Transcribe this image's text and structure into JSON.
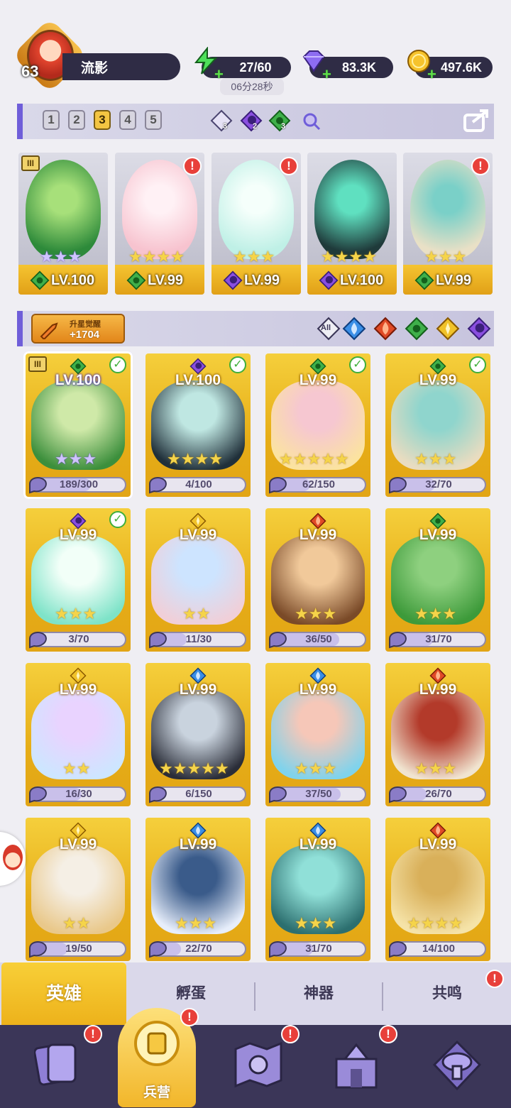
{
  "player": {
    "level": "63",
    "name": "流影"
  },
  "resources": {
    "energy": {
      "value": "27/60",
      "timer": "06分28秒",
      "icon": "lightning-icon"
    },
    "gems": {
      "value": "83.3K",
      "icon": "gem-icon"
    },
    "gold": {
      "value": "497.6K",
      "icon": "coin-icon"
    }
  },
  "team_tabs": [
    "1",
    "2",
    "3",
    "4",
    "5"
  ],
  "active_team_tab": "3",
  "team_element_counts": [
    {
      "element": "light",
      "count": "3"
    },
    {
      "element": "dark",
      "count": "2"
    },
    {
      "element": "nature",
      "count": "3"
    }
  ],
  "lineup": [
    {
      "level": "LV.100",
      "element": "nature",
      "stars": 3,
      "star_color": "purple",
      "tier": "III",
      "alert": false
    },
    {
      "level": "LV.99",
      "element": "nature",
      "stars": 4,
      "star_color": "gold",
      "tier": "",
      "alert": true
    },
    {
      "level": "LV.99",
      "element": "dark",
      "stars": 3,
      "star_color": "gold",
      "tier": "",
      "alert": true
    },
    {
      "level": "LV.100",
      "element": "dark",
      "stars": 4,
      "star_color": "gold",
      "tier": "",
      "alert": false
    },
    {
      "level": "LV.99",
      "element": "nature",
      "stars": 3,
      "star_color": "gold",
      "tier": "",
      "alert": true
    }
  ],
  "awaken": {
    "label": "升星觉醒",
    "value": "+1704"
  },
  "filters": [
    "All",
    "water",
    "fire",
    "nature",
    "light",
    "dark"
  ],
  "filter_all_label": "All",
  "heroes": [
    {
      "level": "LV.100",
      "element": "nature",
      "stars": 3,
      "star_color": "purple",
      "progress": "189/300",
      "ratio": 0.63,
      "checked": true,
      "tier": "III",
      "selected": true
    },
    {
      "level": "LV.100",
      "element": "dark",
      "stars": 4,
      "star_color": "gold",
      "progress": "4/100",
      "ratio": 0.04,
      "checked": true,
      "tier": "",
      "selected": false
    },
    {
      "level": "LV.99",
      "element": "nature",
      "stars": 5,
      "star_color": "gold",
      "progress": "62/150",
      "ratio": 0.41,
      "checked": true,
      "tier": "",
      "selected": false
    },
    {
      "level": "LV.99",
      "element": "nature",
      "stars": 3,
      "star_color": "gold",
      "progress": "32/70",
      "ratio": 0.46,
      "checked": true,
      "tier": "",
      "selected": false
    },
    {
      "level": "LV.99",
      "element": "dark",
      "stars": 3,
      "star_color": "gold",
      "progress": "3/70",
      "ratio": 0.04,
      "checked": true,
      "tier": "",
      "selected": false
    },
    {
      "level": "LV.99",
      "element": "light",
      "stars": 2,
      "star_color": "gold",
      "progress": "11/30",
      "ratio": 0.37,
      "checked": false,
      "tier": "",
      "selected": false
    },
    {
      "level": "LV.99",
      "element": "fire",
      "stars": 3,
      "star_color": "gold",
      "progress": "36/50",
      "ratio": 0.72,
      "checked": false,
      "tier": "",
      "selected": false
    },
    {
      "level": "LV.99",
      "element": "nature",
      "stars": 3,
      "star_color": "gold",
      "progress": "31/70",
      "ratio": 0.44,
      "checked": false,
      "tier": "",
      "selected": false
    },
    {
      "level": "LV.99",
      "element": "light",
      "stars": 2,
      "star_color": "gold",
      "progress": "16/30",
      "ratio": 0.53,
      "checked": false,
      "tier": "",
      "selected": false
    },
    {
      "level": "LV.99",
      "element": "water",
      "stars": 5,
      "star_color": "gold",
      "progress": "6/150",
      "ratio": 0.04,
      "checked": false,
      "tier": "",
      "selected": false
    },
    {
      "level": "LV.99",
      "element": "water",
      "stars": 3,
      "star_color": "gold",
      "progress": "37/50",
      "ratio": 0.74,
      "checked": false,
      "tier": "",
      "selected": false
    },
    {
      "level": "LV.99",
      "element": "fire",
      "stars": 3,
      "star_color": "gold",
      "progress": "26/70",
      "ratio": 0.37,
      "checked": false,
      "tier": "",
      "selected": false
    },
    {
      "level": "LV.99",
      "element": "light",
      "stars": 2,
      "star_color": "gold",
      "progress": "19/50",
      "ratio": 0.38,
      "checked": false,
      "tier": "",
      "selected": false
    },
    {
      "level": "LV.99",
      "element": "water",
      "stars": 3,
      "star_color": "gold",
      "progress": "22/70",
      "ratio": 0.31,
      "checked": false,
      "tier": "",
      "selected": false
    },
    {
      "level": "LV.99",
      "element": "water",
      "stars": 3,
      "star_color": "gold",
      "progress": "31/70",
      "ratio": 0.44,
      "checked": false,
      "tier": "",
      "selected": false
    },
    {
      "level": "LV.99",
      "element": "fire",
      "stars": 4,
      "star_color": "gold",
      "progress": "14/100",
      "ratio": 0.14,
      "checked": false,
      "tier": "",
      "selected": false
    }
  ],
  "sub_tabs": [
    {
      "label": "英雄",
      "active": true,
      "alert": false
    },
    {
      "label": "孵蛋",
      "active": false,
      "alert": false
    },
    {
      "label": "神器",
      "active": false,
      "alert": false
    },
    {
      "label": "共鸣",
      "active": false,
      "alert": true
    }
  ],
  "bottom_nav": [
    {
      "icon": "cards-icon",
      "label": "",
      "alert": true,
      "active": false
    },
    {
      "icon": "barracks-icon",
      "label": "兵营",
      "alert": true,
      "active": true
    },
    {
      "icon": "map-icon",
      "label": "",
      "alert": true,
      "active": false
    },
    {
      "icon": "castle-icon",
      "label": "",
      "alert": true,
      "active": false
    },
    {
      "icon": "mushroom-icon",
      "label": "",
      "alert": false,
      "active": false
    }
  ],
  "alert_glyph": "!",
  "colors": {
    "nature": "#3fb04a",
    "dark": "#8a4fe0",
    "light": "#f0c22a",
    "water": "#3a8ee6",
    "fire": "#e04a26",
    "accent": "#6f5ed9",
    "gold": "#f3c542"
  }
}
